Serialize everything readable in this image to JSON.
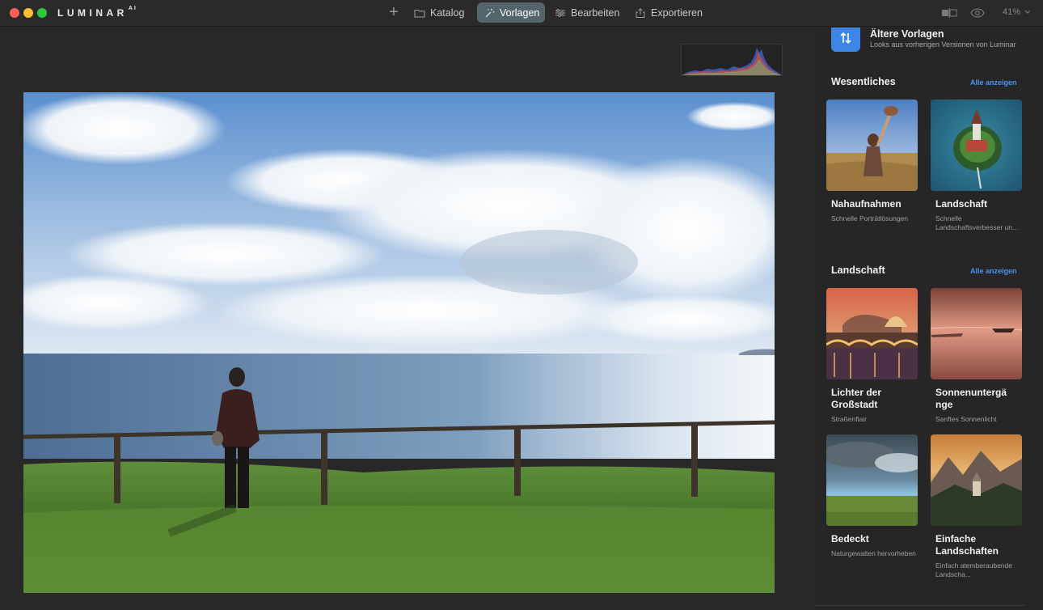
{
  "app": {
    "logo": "LUMINAR",
    "logo_suffix": "AI"
  },
  "nav": {
    "add_label": "+",
    "katalog": "Katalog",
    "vorlagen": "Vorlagen",
    "bearbeiten": "Bearbeiten",
    "exportieren": "Exportieren"
  },
  "toolbar": {
    "zoom": "41%"
  },
  "panel": {
    "older": {
      "title": "Ältere Vorlagen",
      "subtitle": "Looks aus vorherigen Versionen von Luminar"
    },
    "sections": [
      {
        "title": "Wesentliches",
        "link": "Alle anzeigen",
        "cards": [
          {
            "title": "Nahaufnahmen",
            "subtitle": "Schnelle Porträtlösungen"
          },
          {
            "title": "Landschaft",
            "subtitle": "Schnelle Landschaftsverbesser un..."
          }
        ]
      },
      {
        "title": "Landschaft",
        "link": "Alle anzeigen",
        "cards": [
          {
            "title": "Lichter der Großstadt",
            "subtitle": "Straßenflair"
          },
          {
            "title": "Sonnenuntergä nge",
            "subtitle": "Sanftes Sonnenlicht"
          },
          {
            "title": "Bedeckt",
            "subtitle": "Naturgewalten hervorheben"
          },
          {
            "title": "Einfache Landschaften",
            "subtitle": "Einfach atemberaubende Landscha..."
          }
        ]
      }
    ]
  },
  "colors": {
    "accent": "#4a92f2",
    "active_tab": "#54646b",
    "older_icon": "#3d86e6"
  }
}
